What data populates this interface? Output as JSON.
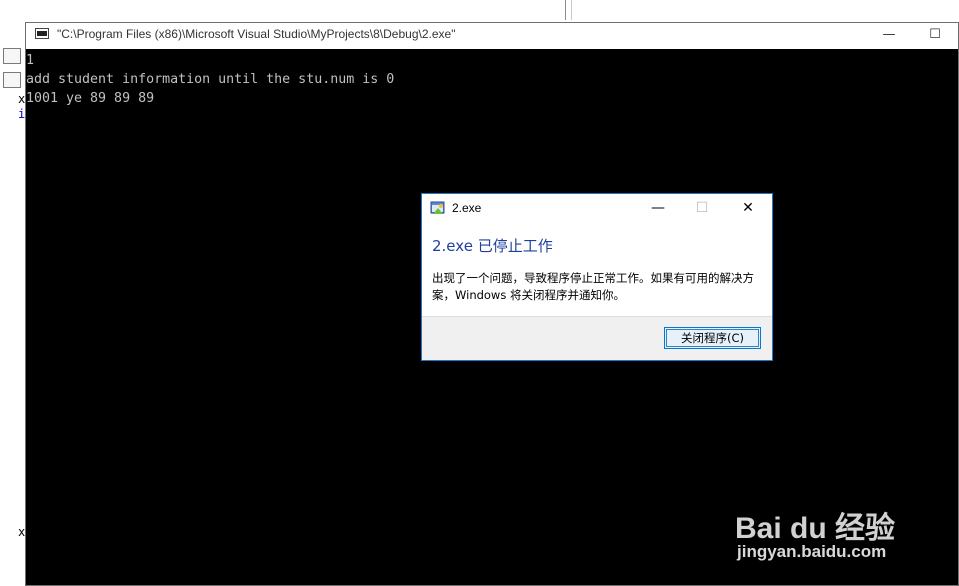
{
  "console": {
    "title": "\"C:\\Program Files (x86)\\Microsoft Visual Studio\\MyProjects\\8\\Debug\\2.exe\"",
    "minimize_label": "—",
    "maximize_label": "☐",
    "lines": [
      "1",
      "add student information until the stu.num is 0",
      "1001 ye 89 89 89"
    ]
  },
  "background": {
    "glyph_top": "x",
    "glyph_mid": "i",
    "glyph_bottom": "x"
  },
  "dialog": {
    "title": "2.exe",
    "minimize_label": "—",
    "maximize_label": "☐",
    "close_label": "✕",
    "heading": "2.exe 已停止工作",
    "message": "出现了一个问题，导致程序停止正常工作。如果有可用的解决方案，Windows 将关闭程序并通知你。",
    "close_button_label": "关闭程序(C)"
  },
  "watermark": {
    "logo": "Bai du 经验",
    "url": "jingyan.baidu.com"
  },
  "colors": {
    "dialog_border": "#1979ca",
    "heading": "#1f3f9f",
    "console_text": "#c0c0c0"
  }
}
